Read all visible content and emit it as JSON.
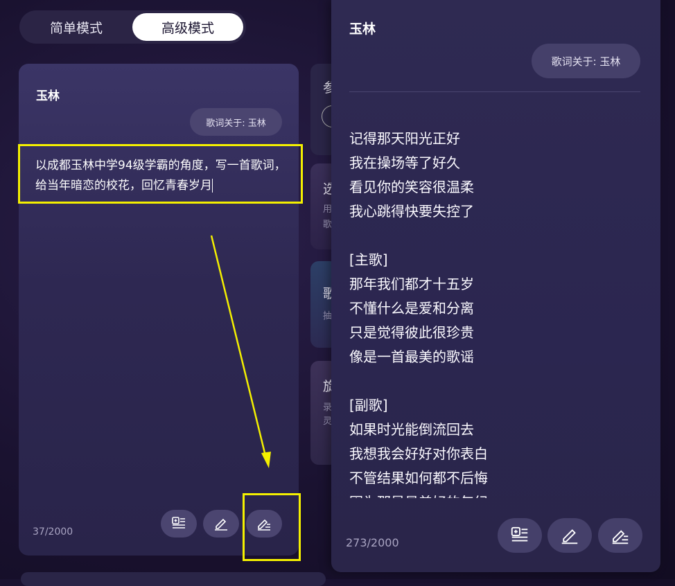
{
  "mode_toggle": {
    "simple": "简单模式",
    "advanced": "高级模式"
  },
  "left_card": {
    "title": "玉林",
    "topic_pill": "歌词关于: 玉林",
    "prompt": "以成都玉林中学94级学霸的角度，写一首歌词，给当年暗恋的校花，回忆青春岁月",
    "counter": "37/2000",
    "buttons": [
      "add-lines-icon",
      "pen-icon",
      "rewrite-icon"
    ]
  },
  "middle_cards": [
    {
      "title": "参",
      "sub": ""
    },
    {
      "title": "选",
      "sub": "用 歌"
    },
    {
      "title": "歌",
      "sub": "抽"
    },
    {
      "title": "旋",
      "sub": "录 灵"
    }
  ],
  "right_panel": {
    "title": "玉林",
    "topic_pill": "歌词关于: 玉林",
    "lyrics": [
      "记得那天阳光正好",
      "我在操场等了好久",
      "看见你的笑容很温柔",
      "我心跳得快要失控了",
      "",
      "[主歌]",
      "那年我们都才十五岁",
      "不懂什么是爱和分离",
      "只是觉得彼此很珍贵",
      "像是一首最美的歌谣",
      "",
      "[副歌]",
      "如果时光能倒流回去",
      "我想我会好好对你表白",
      "不管结果如何都不后悔",
      "因为那是最美好的年纪"
    ],
    "counter": "273/2000",
    "buttons": [
      "add-lines-icon",
      "pen-icon",
      "rewrite-icon"
    ]
  },
  "colors": {
    "highlight": "#f4f000",
    "accent_white": "#ffffff"
  }
}
